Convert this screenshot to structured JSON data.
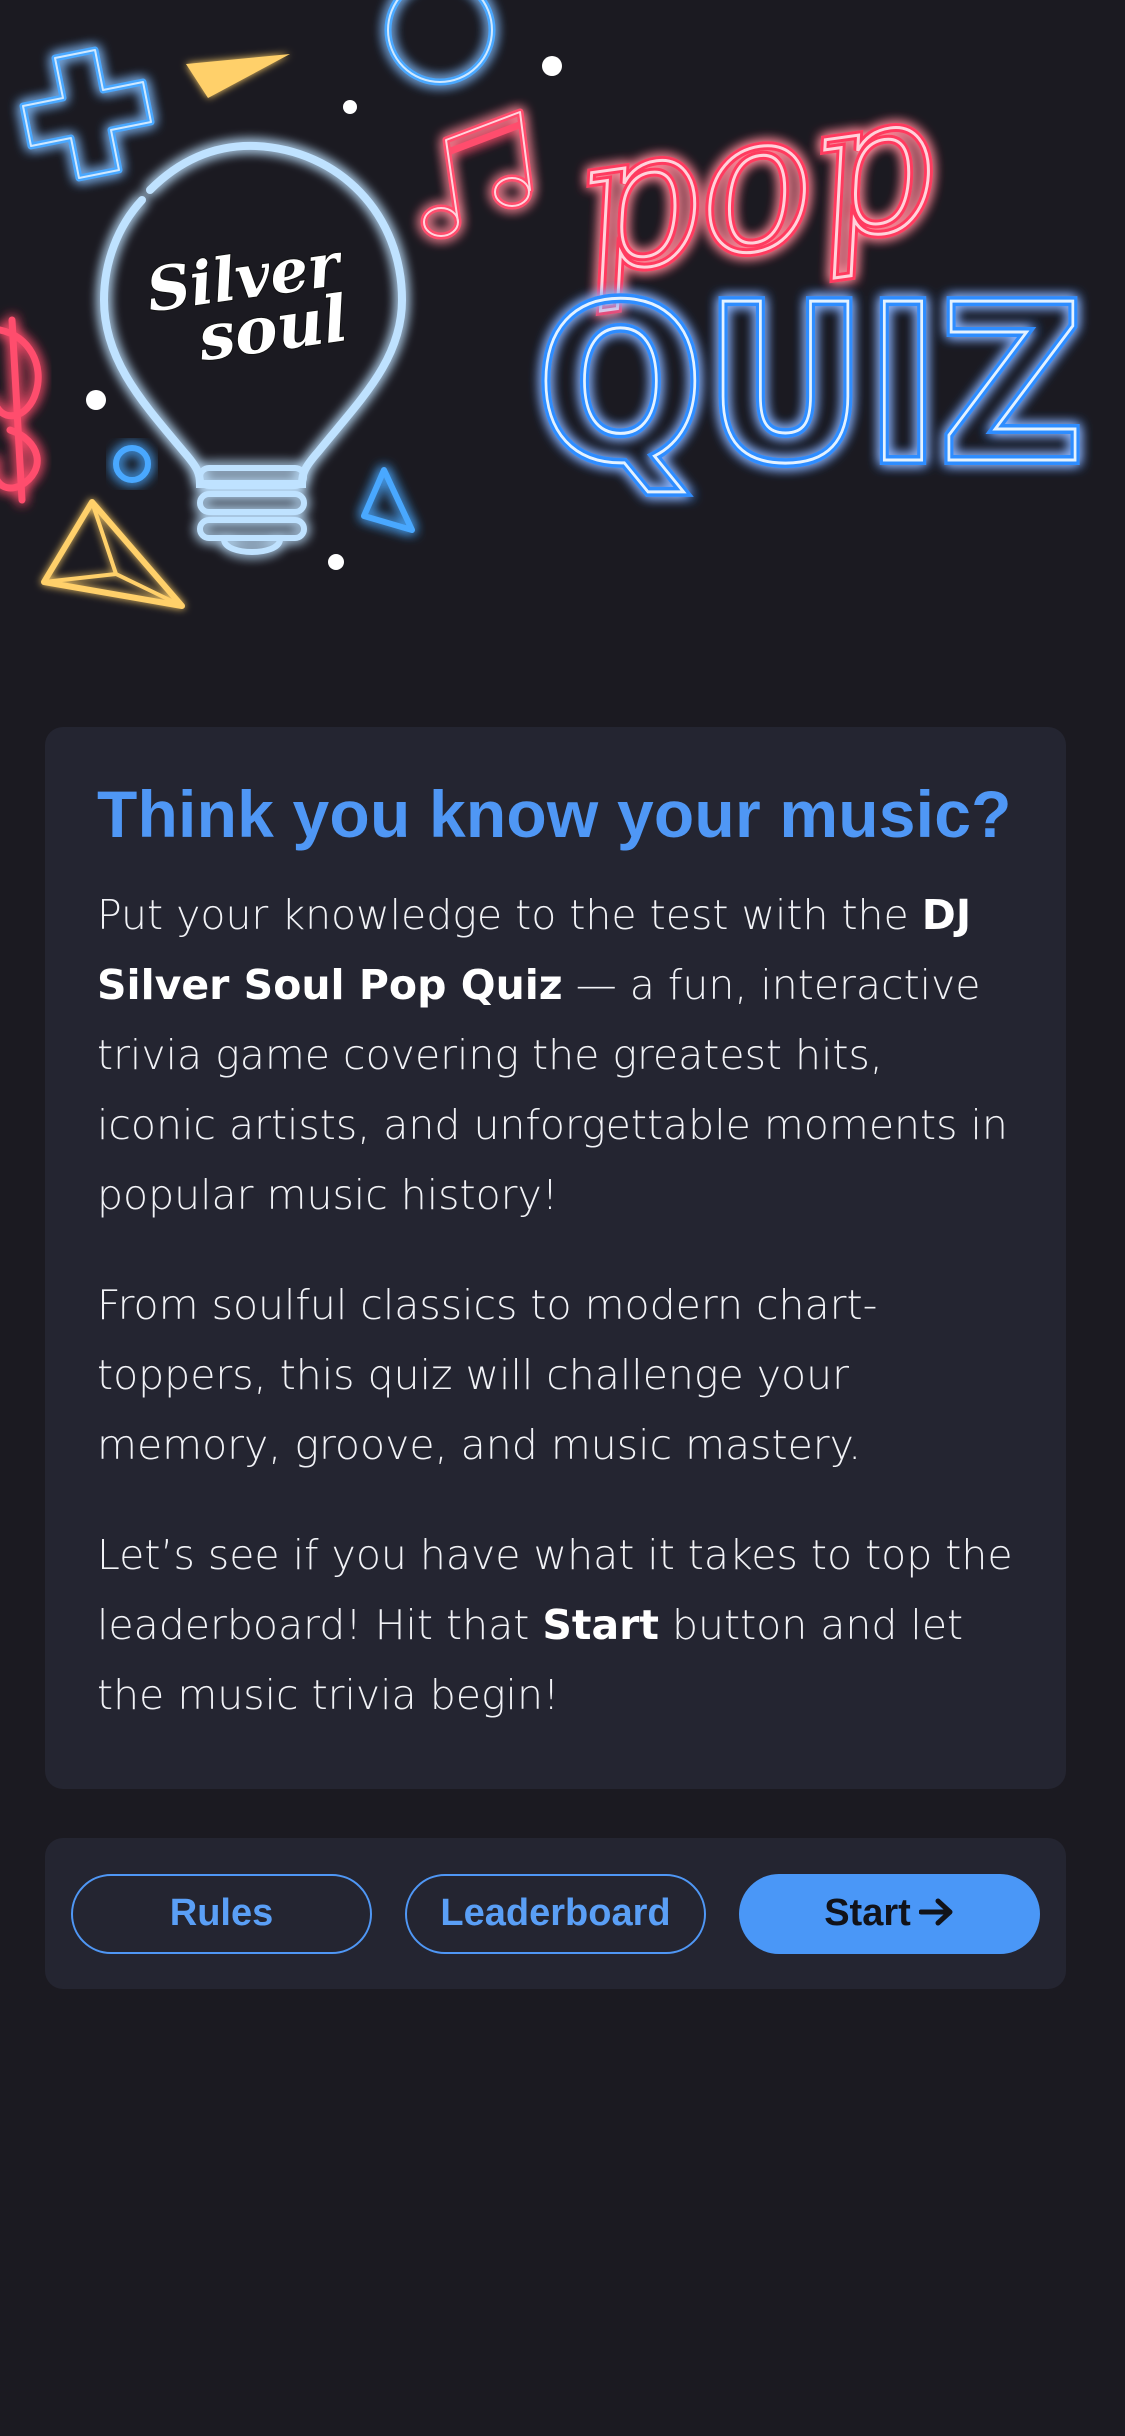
{
  "hero": {
    "logo_line_1": "Silver",
    "logo_line_2": "soul",
    "pop_text": "pop",
    "quiz_text": "QUIZ"
  },
  "card": {
    "title": "Think you know your music?",
    "para1_intro": "Put your knowledge to the test with the ",
    "para1_bold": "DJ Silver Soul Pop Quiz",
    "para1_rest": " — a fun, interactive trivia game covering the greatest hits, iconic artists, and unforgettable moments in popular music history!",
    "para2": "From soulful classics to modern chart-toppers, this quiz will challenge your memory, groove, and music mastery.",
    "para3_intro": "Let’s see if you have what it takes to top the leaderboard! Hit that ",
    "para3_bold": "Start",
    "para3_rest": " button and let the music trivia begin!"
  },
  "actions": {
    "rules_label": "Rules",
    "leaderboard_label": "Leaderboard",
    "start_label": "Start",
    "start_icon": "arrow-right-icon"
  },
  "colors": {
    "background": "#1b1a21",
    "card": "#242531",
    "accent_blue": "#4f97f5",
    "neon_pink": "#ff4d6d",
    "neon_blue": "#4aa8ff",
    "neon_yellow": "#ffd76a"
  }
}
